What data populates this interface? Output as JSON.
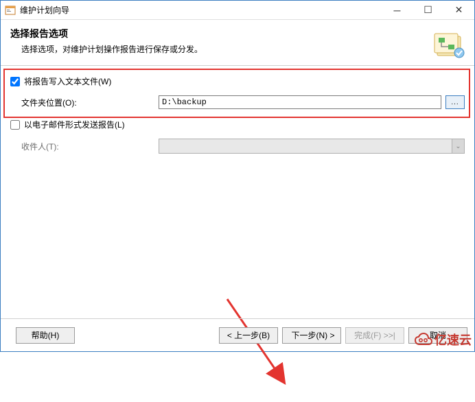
{
  "titlebar": {
    "title": "维护计划向导"
  },
  "header": {
    "title": "选择报告选项",
    "desc": "选择选项，对维护计划操作报告进行保存或分发。"
  },
  "writeFile": {
    "checkbox_label": "将报告写入文本文件(W)",
    "checked": true,
    "folder_label": "文件夹位置(O):",
    "folder_value": "D:\\backup",
    "browse_label": "..."
  },
  "email": {
    "checkbox_label": "以电子邮件形式发送报告(L)",
    "checked": false,
    "recipient_label": "收件人(T):"
  },
  "footer": {
    "help": "帮助(H)",
    "back": "< 上一步(B)",
    "next": "下一步(N) >",
    "finish": "完成(F) >>|",
    "cancel": "取消"
  },
  "watermark": {
    "text": "亿速云"
  }
}
